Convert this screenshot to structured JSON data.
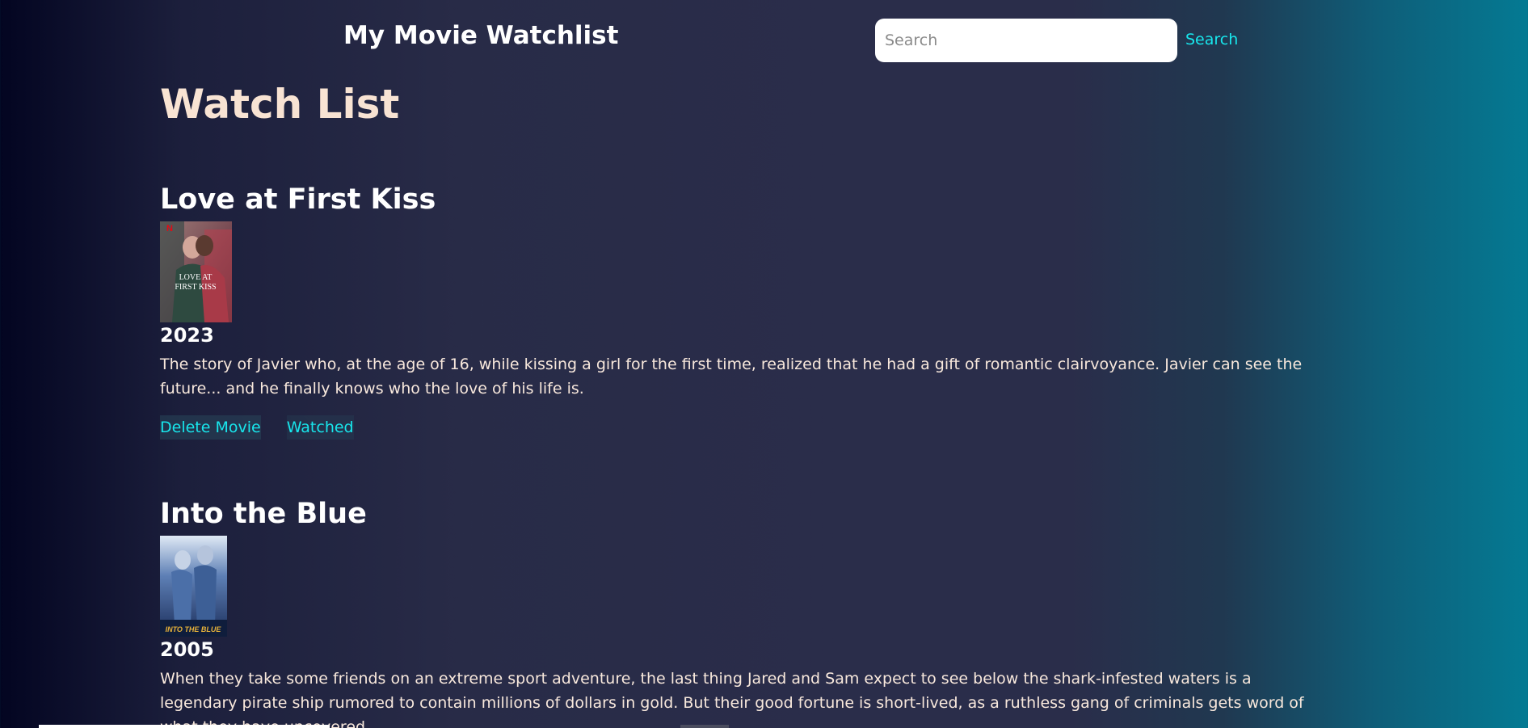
{
  "header": {
    "site_title": "My Movie Watchlist",
    "search_placeholder": "Search",
    "search_value": "",
    "search_button_label": "Search"
  },
  "page": {
    "heading": "Watch List"
  },
  "movies": [
    {
      "title": "Love at First Kiss",
      "poster_text": "LOVE AT FIRST KISS",
      "poster_badge": "N",
      "year": "2023",
      "description": "The story of Javier who, at the age of 16, while kissing a girl for the first time, realized that he had a gift of romantic clairvoyance. Javier can see the future... and he finally knows who the love of his life is.",
      "delete_label": "Delete Movie",
      "watched_label": "Watched"
    },
    {
      "title": "Into the Blue",
      "poster_text": "INTO THE BLUE",
      "year": "2005",
      "description": "When they take some friends on an extreme sport adventure, the last thing Jared and Sam expect to see below the shark-infested waters is a legendary pirate ship rumored to contain millions of dollars in gold. But their good fortune is short-lived, as a ruthless gang of criminals gets word of what they have uncovered."
    }
  ],
  "colors": {
    "accent": "#18e6ec",
    "heading": "#f8e3d3",
    "background_dark": "#030521",
    "background_teal": "#047a93"
  }
}
